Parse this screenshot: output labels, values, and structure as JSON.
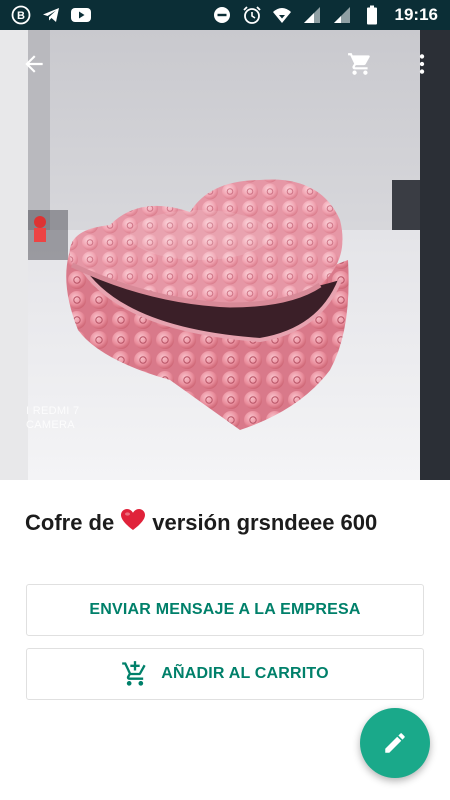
{
  "status_bar": {
    "time": "19:16",
    "left_icons": [
      "b-icon",
      "telegram-icon",
      "youtube-icon"
    ],
    "right_icons": [
      "do-not-disturb-icon",
      "alarm-icon",
      "wifi-icon",
      "signal-icon",
      "signal-icon",
      "battery-icon"
    ]
  },
  "app_bar": {
    "back_icon": "arrow-back-icon",
    "cart_icon": "shopping-cart-icon",
    "more_icon": "more-vertical-icon"
  },
  "photo": {
    "watermark_line1": "I REDMI 7",
    "watermark_line2": "CAMERA"
  },
  "product": {
    "title_before": "Cofre de",
    "title_emoji": "heart-emoji",
    "title_after": "versión grsndeee 600"
  },
  "actions": {
    "message_label": "ENVIAR MENSAJE A LA EMPRESA",
    "add_to_cart_label": "AÑADIR AL CARRITO",
    "add_to_cart_icon": "add-shopping-cart-icon"
  },
  "fab": {
    "icon": "edit-pencil-icon"
  },
  "colors": {
    "status_bar": "#0b2e36",
    "accent": "#00806a",
    "fab": "#1aa98a",
    "heart": "#e0223a"
  }
}
